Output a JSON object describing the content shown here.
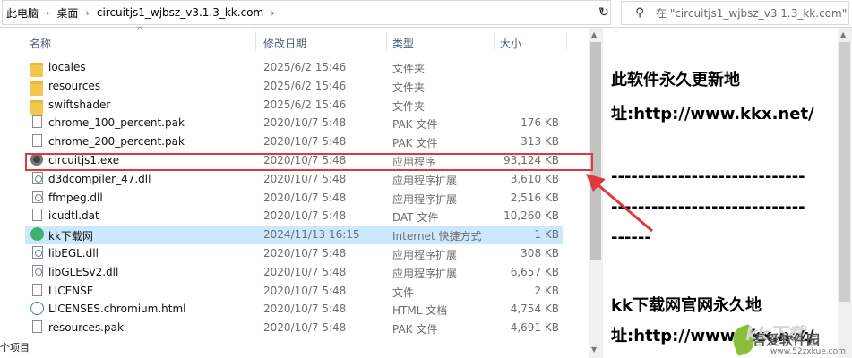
{
  "address": {
    "breadcrumbs": [
      "此电脑",
      "桌面",
      "circuitjs1_wjbsz_v3.1.3_kk.com"
    ],
    "search_placeholder": "在 \"circuitjs1_wjbsz_v3.1.3_kk.com\""
  },
  "columns": {
    "name": "名称",
    "date": "修改日期",
    "type": "类型",
    "size": "大小"
  },
  "files": [
    {
      "name": "locales",
      "date": "2025/6/2 15:46",
      "type": "文件夹",
      "size": "",
      "icon": "folder-icon"
    },
    {
      "name": "resources",
      "date": "2025/6/2 15:46",
      "type": "文件夹",
      "size": "",
      "icon": "folder-icon"
    },
    {
      "name": "swiftshader",
      "date": "2025/6/2 15:46",
      "type": "文件夹",
      "size": "",
      "icon": "folder-icon"
    },
    {
      "name": "chrome_100_percent.pak",
      "date": "2020/10/7 5:48",
      "type": "PAK 文件",
      "size": "176 KB",
      "icon": "file-icon"
    },
    {
      "name": "chrome_200_percent.pak",
      "date": "2020/10/7 5:48",
      "type": "PAK 文件",
      "size": "313 KB",
      "icon": "file-icon"
    },
    {
      "name": "circuitjs1.exe",
      "date": "2020/10/7 5:48",
      "type": "应用程序",
      "size": "93,124 KB",
      "icon": "app-icon"
    },
    {
      "name": "d3dcompiler_47.dll",
      "date": "2020/10/7 5:48",
      "type": "应用程序扩展",
      "size": "3,610 KB",
      "icon": "dll-icon"
    },
    {
      "name": "ffmpeg.dll",
      "date": "2020/10/7 5:48",
      "type": "应用程序扩展",
      "size": "2,516 KB",
      "icon": "dll-icon"
    },
    {
      "name": "icudtl.dat",
      "date": "2020/10/7 5:48",
      "type": "DAT 文件",
      "size": "10,260 KB",
      "icon": "file-icon"
    },
    {
      "name": "kk下载网",
      "date": "2024/11/13 16:15",
      "type": "Internet 快捷方式",
      "size": "1 KB",
      "icon": "shortcut-icon"
    },
    {
      "name": "libEGL.dll",
      "date": "2020/10/7 5:48",
      "type": "应用程序扩展",
      "size": "308 KB",
      "icon": "dll-icon"
    },
    {
      "name": "libGLESv2.dll",
      "date": "2020/10/7 5:48",
      "type": "应用程序扩展",
      "size": "6,657 KB",
      "icon": "dll-icon"
    },
    {
      "name": "LICENSE",
      "date": "2020/10/7 5:48",
      "type": "文件",
      "size": "2 KB",
      "icon": "file-icon"
    },
    {
      "name": "LICENSES.chromium.html",
      "date": "2020/10/7 5:48",
      "type": "HTML 文档",
      "size": "4,754 KB",
      "icon": "html-icon"
    },
    {
      "name": "resources.pak",
      "date": "2020/10/7 5:48",
      "type": "PAK 文件",
      "size": "4,691 KB",
      "icon": "file-icon"
    }
  ],
  "selected_row": "kk下载网",
  "status": {
    "items_text": "个项目"
  },
  "preview": {
    "lines": [
      "此软件永久更新地",
      "址:http://www.kkx.net/",
      "",
      "-----------------------------",
      "-----------------------------",
      "------",
      "",
      "kk下载网官网永久地",
      "址:http://www.kkx.net/"
    ]
  },
  "watermark": {
    "text1": "kk下载",
    "text2": "吾爱软件园",
    "text3": "www.52zxkue.com"
  },
  "colors": {
    "highlight": "#e0393b",
    "selection": "#cce8ff"
  }
}
